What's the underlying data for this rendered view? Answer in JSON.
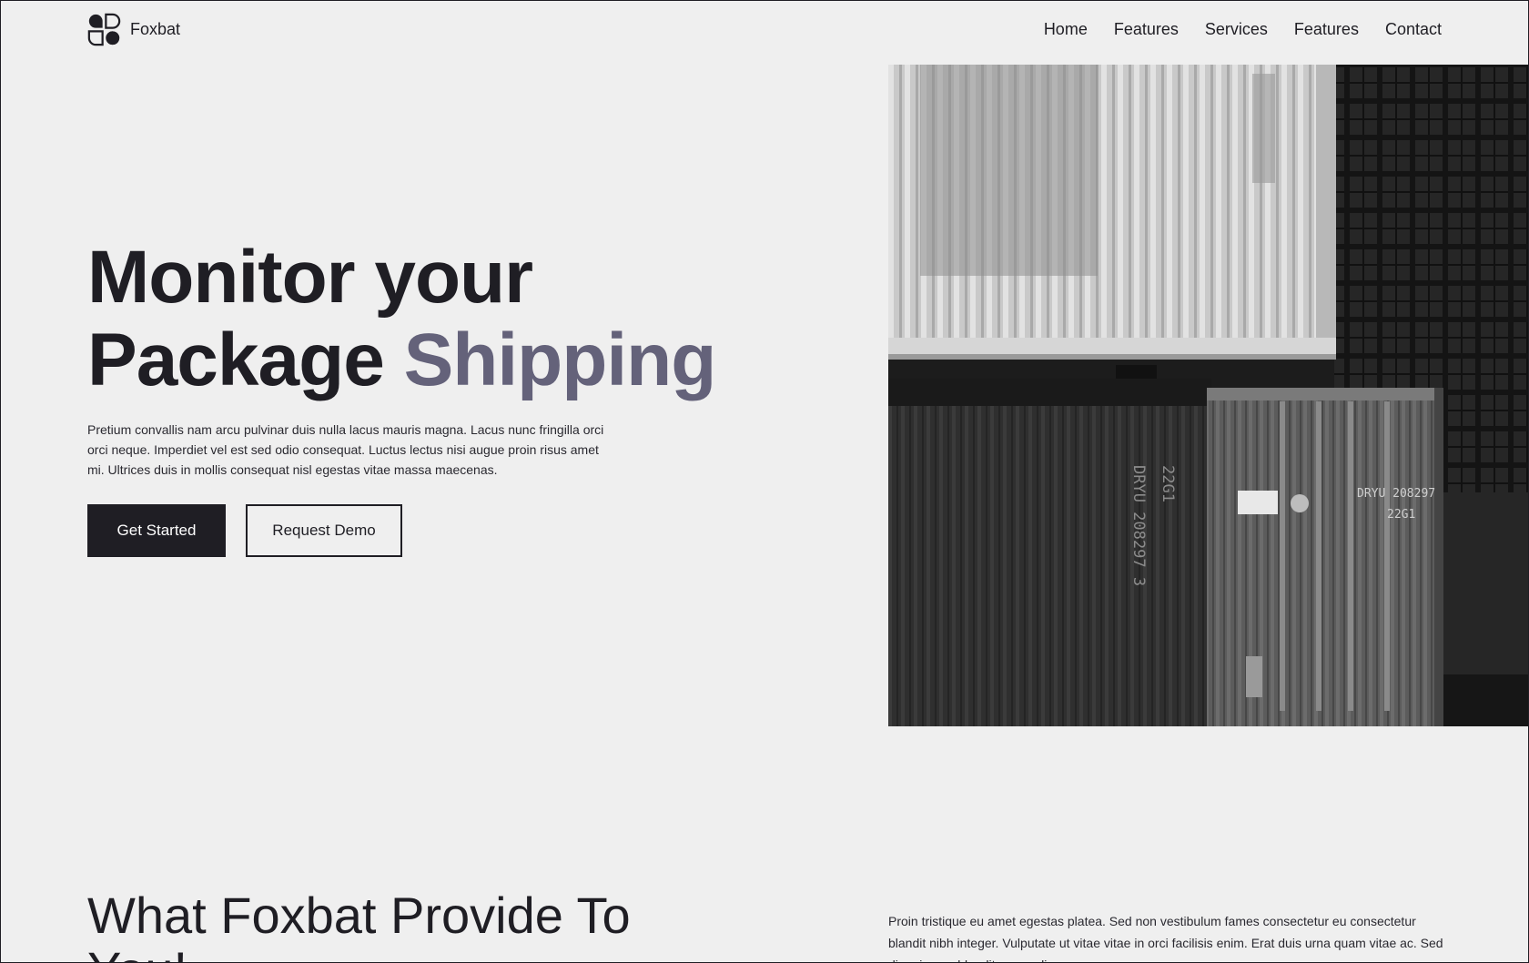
{
  "brand": {
    "name": "Foxbat",
    "logo_icon": "foxbat-logo-icon"
  },
  "nav": {
    "items": [
      {
        "label": "Home"
      },
      {
        "label": "Features"
      },
      {
        "label": "Services"
      },
      {
        "label": "Features"
      },
      {
        "label": "Contact"
      }
    ]
  },
  "hero": {
    "title_line1": "Monitor your",
    "title_line2_a": "Package",
    "title_line2_b": "Shipping",
    "description": "Pretium convallis nam arcu pulvinar duis nulla lacus mauris magna. Lacus nunc fringilla orci orci neque. Imperdiet vel est sed odio consequat. Luctus lectus nisi augue proin risus amet mi. Ultrices duis in mollis consequat nisl egestas vitae massa maecenas.",
    "primary_button": "Get Started",
    "secondary_button": "Request Demo",
    "image_texts": {
      "container_code_vertical": "DRYU 208297 3",
      "container_type_vertical": "22G1",
      "door_code": "DRYU 208297",
      "door_type": "22G1"
    }
  },
  "provide": {
    "title": "What Foxbat Provide To You!",
    "description": "Proin tristique eu amet egestas platea. Sed non vestibulum fames consectetur eu consectetur blandit nibh integer. Vulputate ut vitae vitae in orci facilisis enim. Erat duis urna quam vitae ac. Sed diam in non blandit nunc odio."
  },
  "colors": {
    "background": "#efefef",
    "text": "#1f1e24",
    "accent": "#64627a",
    "button_primary_bg": "#1f1e24"
  }
}
